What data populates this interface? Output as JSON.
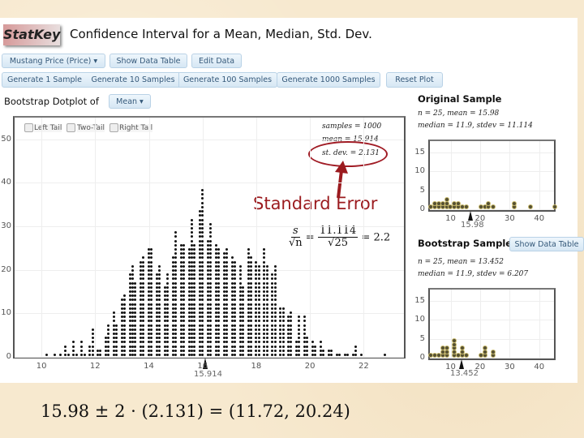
{
  "header": {
    "logo": "StatKey",
    "title": "Confidence Interval for a Mean, Median, Std. Dev."
  },
  "toolbar": {
    "dataset_dropdown": "Mustang Price (Price) ▾",
    "show_data_table": "Show Data Table",
    "edit_data": "Edit Data"
  },
  "generate": {
    "gen1": "Generate 1 Sample",
    "gen10": "Generate 10 Samples",
    "gen100": "Generate 100 Samples",
    "gen1000": "Generate 1000 Samples",
    "reset": "Reset Plot"
  },
  "dotplot": {
    "label": "Bootstrap Dotplot of",
    "statistic_dropdown": "Mean ▾",
    "left_tail": "Left Tail",
    "two_tail": "Two-Tail",
    "right_tail": "Right Tail",
    "samples": "samples = 1000",
    "mean": "mean = 15.914",
    "stdev": "st. dev. = 2.131",
    "marker_value": "15.914"
  },
  "original": {
    "title": "Original Sample",
    "line1": "n = 25, mean = 15.98",
    "line2": "median = 11.9, stdev = 11.114",
    "marker_value": "15.98"
  },
  "bootstrap": {
    "title": "Bootstrap Sample",
    "show_data_table": "Show Data Table",
    "line1": "n = 25, mean = 13.452",
    "line2": "median = 11.9, stdev = 6.207",
    "marker_value": "13.452"
  },
  "annotation": {
    "label": "Standard Error",
    "se_s": "s",
    "se_sqrt_n": "√n",
    "se_num": "11.114",
    "se_den": "√25",
    "se_result": "= 2.2",
    "ci_formula": "15.98 ± 2 · (2.131) = (11.72, 20.24)"
  },
  "colors": {
    "accent_red": "#9b1b1f",
    "button_text": "#35597a"
  },
  "chart_data": [
    {
      "type": "scatter",
      "title": "Bootstrap Dotplot of Mean",
      "xlabel": "",
      "ylabel": "",
      "xlim": [
        9,
        23.5
      ],
      "ylim": [
        0,
        55
      ],
      "x_ticks": [
        "10",
        "12",
        "14",
        "16",
        "18",
        "20",
        "22"
      ],
      "y_ticks": [
        "0",
        "10",
        "20",
        "30",
        "40",
        "50"
      ],
      "grid": true,
      "bin_centers": [
        10.2,
        10.5,
        10.7,
        10.9,
        11.0,
        11.2,
        11.3,
        11.5,
        11.6,
        11.8,
        11.9,
        12.1,
        12.2,
        12.4,
        12.5,
        12.7,
        12.8,
        13.0,
        13.1,
        13.3,
        13.4,
        13.5,
        13.7,
        13.8,
        14.0,
        14.1,
        14.3,
        14.4,
        14.6,
        14.7,
        14.9,
        15.0,
        15.2,
        15.3,
        15.5,
        15.6,
        15.7,
        15.9,
        16.0,
        16.2,
        16.3,
        16.5,
        16.6,
        16.8,
        16.9,
        17.1,
        17.2,
        17.4,
        17.5,
        17.7,
        17.8,
        18.0,
        18.1,
        18.3,
        18.4,
        18.6,
        18.7,
        18.9,
        19.0,
        19.2,
        19.3,
        19.5,
        19.6,
        19.8,
        19.9,
        20.1,
        20.2,
        20.4,
        20.5,
        20.7,
        20.8,
        21.0,
        21.1,
        21.3,
        21.4,
        21.6,
        21.7,
        21.9,
        22.8
      ],
      "counts": [
        1,
        1,
        1,
        3,
        1,
        4,
        1,
        4,
        1,
        3,
        7,
        2,
        2,
        5,
        8,
        11,
        8,
        14,
        15,
        20,
        22,
        18,
        23,
        24,
        26,
        26,
        20,
        22,
        17,
        20,
        24,
        30,
        27,
        27,
        26,
        33,
        27,
        35,
        40,
        28,
        32,
        27,
        26,
        25,
        26,
        24,
        23,
        22,
        17,
        26,
        24,
        23,
        22,
        26,
        22,
        20,
        22,
        12,
        12,
        10,
        11,
        4,
        10,
        10,
        5,
        4,
        3,
        4,
        2,
        2,
        2,
        1,
        1,
        1,
        1,
        1,
        3,
        1,
        1
      ],
      "summary": {
        "samples": 1000,
        "mean": 15.914,
        "st_dev": 2.131
      }
    },
    {
      "type": "scatter",
      "title": "Original Sample",
      "xlim": [
        3,
        45
      ],
      "ylim": [
        0,
        18
      ],
      "x_ticks": [
        "10",
        "20",
        "30",
        "40"
      ],
      "y_ticks": [
        "0",
        "5",
        "10",
        "15"
      ],
      "values": [
        3.0,
        4.4,
        4.4,
        5.7,
        5.7,
        7.0,
        7.0,
        8.4,
        8.4,
        8.4,
        9.7,
        11.0,
        11.0,
        12.4,
        12.4,
        13.7,
        15.0,
        20.1,
        21.4,
        22.6,
        22.6,
        24.0,
        31.4,
        31.4,
        36.7,
        44.9
      ],
      "mean": 15.98
    },
    {
      "type": "scatter",
      "title": "Bootstrap Sample",
      "xlim": [
        3,
        45
      ],
      "ylim": [
        0,
        18
      ],
      "x_ticks": [
        "10",
        "20",
        "30",
        "40"
      ],
      "y_ticks": [
        "0",
        "5",
        "10",
        "15"
      ],
      "values": [
        3.0,
        4.4,
        5.7,
        7.0,
        7.0,
        7.0,
        8.4,
        8.4,
        8.4,
        11.0,
        11.0,
        11.0,
        11.0,
        11.0,
        12.4,
        13.7,
        13.7,
        13.7,
        15.0,
        20.1,
        21.4,
        21.4,
        21.4,
        24.0,
        24.0
      ],
      "mean": 13.452
    }
  ]
}
